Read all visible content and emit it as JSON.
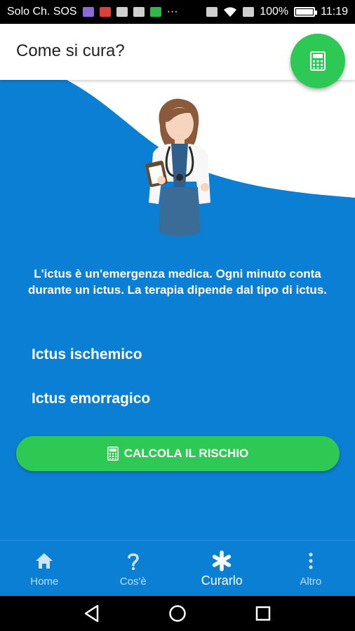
{
  "status_bar": {
    "carrier": "Solo Ch. SOS",
    "battery": "100%",
    "time": "11:19",
    "icons": [
      "app-icon",
      "gmail-icon",
      "image-icon",
      "mail-icon",
      "app-icon",
      "more-icon",
      "nfc-icon",
      "wifi-icon",
      "sim-icon",
      "battery-icon"
    ]
  },
  "app_bar": {
    "title": "Come si cura?",
    "fab_icon": "calculator-icon"
  },
  "main": {
    "intro": "L'ictus è un'emergenza medica. Ogni minuto conta durante un ictus. La terapia dipende dal tipo di ictus.",
    "options": [
      {
        "label": "Ictus ischemico"
      },
      {
        "label": "Ictus emorragico"
      }
    ],
    "calc_button": {
      "label": "CALCOLA IL RISCHIO",
      "icon": "calculator-icon"
    }
  },
  "bottom_nav": {
    "items": [
      {
        "label": "Home",
        "icon": "home-icon",
        "active": false
      },
      {
        "label": "Cos'è",
        "icon": "question-icon",
        "active": false
      },
      {
        "label": "Curarlo",
        "icon": "asterisk-icon",
        "active": true
      },
      {
        "label": "Altro",
        "icon": "more-vertical-icon",
        "active": false
      }
    ]
  },
  "colors": {
    "primary_blue": "#0b7fd3",
    "accent_green": "#2ec954"
  }
}
